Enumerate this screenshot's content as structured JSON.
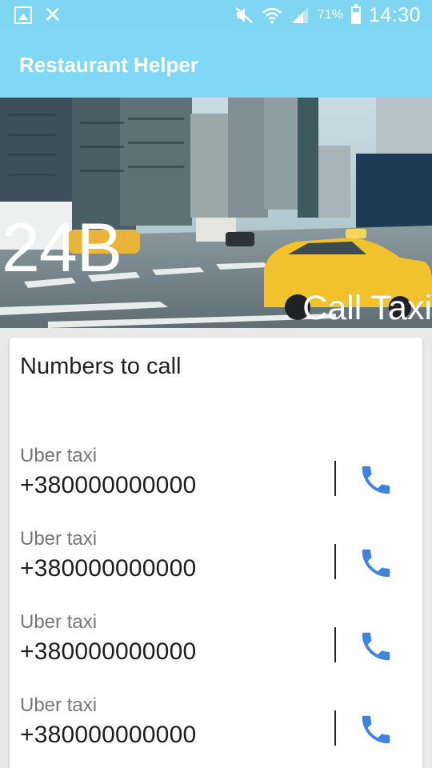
{
  "status_bar": {
    "battery_percent": "71%",
    "battery_level": 0.71,
    "time": "14:30",
    "icons": [
      "gallery-icon",
      "close-x-icon",
      "mute-icon",
      "wifi-icon",
      "signal-icon",
      "battery-icon"
    ]
  },
  "app_bar": {
    "title": "Restaurant Helper"
  },
  "hero": {
    "code": "24B",
    "action_label": "Call Taxi"
  },
  "card": {
    "title": "Numbers to call",
    "contacts": [
      {
        "name": "Uber taxi",
        "number": "+380000000000"
      },
      {
        "name": "Uber taxi",
        "number": "+380000000000"
      },
      {
        "name": "Uber taxi",
        "number": "+380000000000"
      },
      {
        "name": "Uber taxi",
        "number": "+380000000000"
      }
    ]
  },
  "colors": {
    "app_bar": "#81d8f6",
    "status_bar": "#7fd6f3",
    "call_icon": "#3f83e0"
  }
}
